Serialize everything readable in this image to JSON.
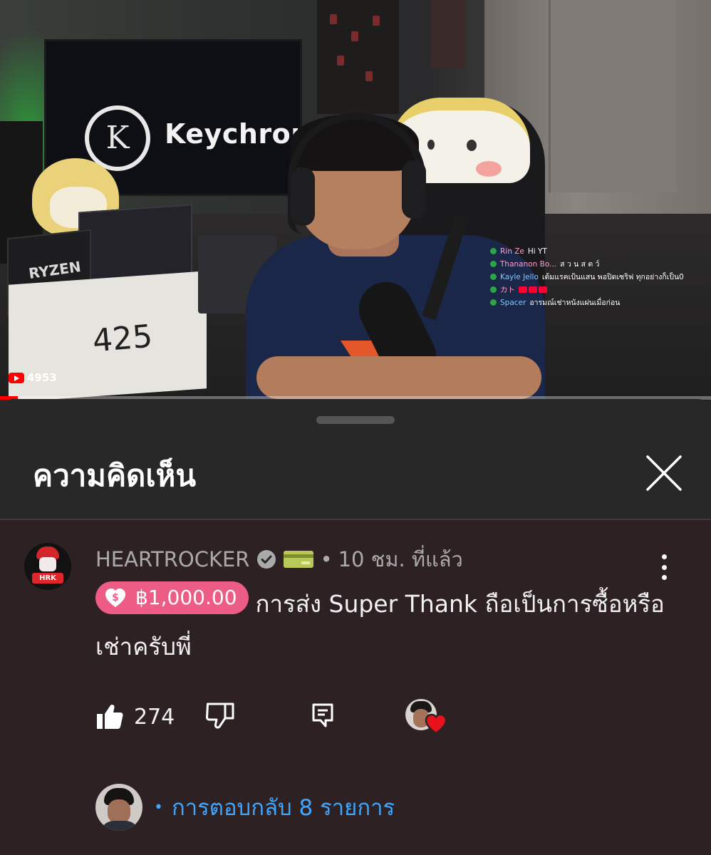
{
  "video": {
    "tv_brand": "Keychron",
    "tv_logo_letter": "K",
    "box_label": "RYZEN",
    "box_number": "425",
    "viewer_count": "4953",
    "progress_fraction": 0.025,
    "live_chat": [
      {
        "name": "Rin Ze",
        "message": "Hi YT",
        "name_color": "pink"
      },
      {
        "name": "Thananon Bo...",
        "message": "ส ว น ส ต ว์",
        "name_color": "pink"
      },
      {
        "name": "Kayle Jello",
        "message": "เต้มแรคเป้นแสน พอปิดเซริฟ ทุกอย่างก็เป็น0",
        "name_color": "blue"
      },
      {
        "name": "カト",
        "message": "",
        "name_color": "pink",
        "emotes": 3
      },
      {
        "name": "Spacer",
        "message": "อารมณ์เช่าหนังแผ่นเมื่อก่อน",
        "name_color": "blue"
      }
    ]
  },
  "sheet": {
    "title": "ความคิดเห็น",
    "close_icon": "close-icon"
  },
  "comment": {
    "author": "HEARTROCKER",
    "avatar_label": "HRK",
    "separator": "•",
    "time": "10 ชม. ที่แล้ว",
    "super_thanks_amount": "฿1,000.00",
    "text": "การส่ง Super Thank ถือเป็นการซื้อหรือเช่าครับพี่",
    "like_count": "274",
    "chip_color": "#ec5c84",
    "link_color": "#3ea6ff"
  },
  "replies": {
    "dot": "•",
    "label": "การตอบกลับ 8 รายการ"
  }
}
